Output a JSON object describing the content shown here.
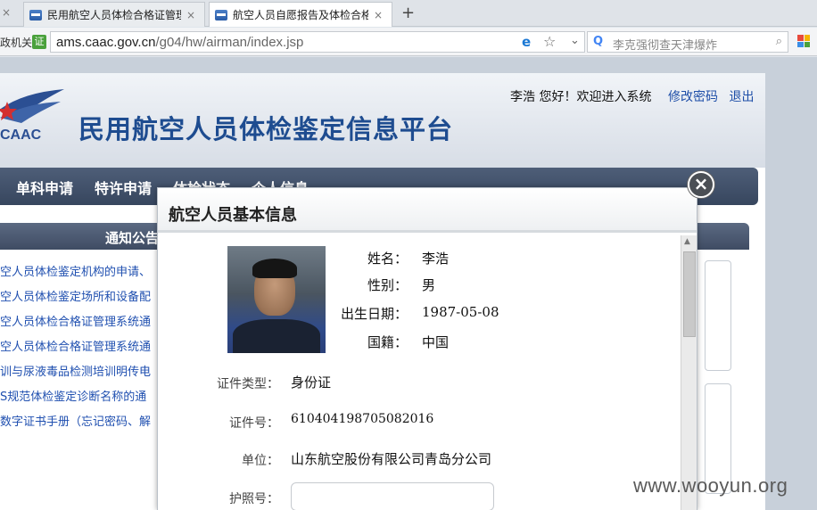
{
  "browser": {
    "tabs": [
      {
        "title": "民用航空人员体检合格证管理",
        "active": false
      },
      {
        "title": "航空人员自愿报告及体检合格",
        "active": true
      }
    ],
    "left_tab_close": "×",
    "tab_close": "×",
    "new_tab": "+",
    "addr_left": "政机关",
    "shield": "证",
    "url_host": "ams.caac.gov.cn",
    "url_path": "/g04/hw/airman/index.jsp",
    "search_placeholder": "李克强彻查天津爆炸"
  },
  "site": {
    "title": "民用航空人员体检鉴定信息平台",
    "logo_text": "CAAC",
    "welcome": "李浩  您好！欢迎进入系统",
    "links": [
      "修改密码",
      "退出"
    ],
    "nav": [
      "单科申请",
      "特许申请",
      "体检状态",
      "个人信息"
    ],
    "notice_title": "通知公告",
    "notices": [
      "空人员体检鉴定机构的申请、",
      "空人员体检鉴定场所和设备配",
      "空人员体检合格证管理系统通",
      "空人员体检合格证管理系统通",
      "训与尿液毒品检测培训明传电",
      "S规范体检鉴定诊断名称的通",
      "数字证书手册（忘记密码、解"
    ]
  },
  "modal": {
    "title": "航空人员基本信息",
    "close": "×",
    "fields": [
      {
        "label": "姓名：",
        "value": "李浩"
      },
      {
        "label": "性别：",
        "value": "男"
      },
      {
        "label": "出生日期：",
        "value": "1987-05-08"
      },
      {
        "label": "国籍：",
        "value": "中国"
      }
    ],
    "details": [
      {
        "label": "证件类型：",
        "value": "身份证"
      },
      {
        "label": "证件号：",
        "value": "610404198705082016"
      },
      {
        "label": "单位：",
        "value": "山东航空股份有限公司青岛分公司"
      },
      {
        "label": "护照号：",
        "value": ""
      }
    ]
  },
  "watermark": "www.wooyun.org"
}
